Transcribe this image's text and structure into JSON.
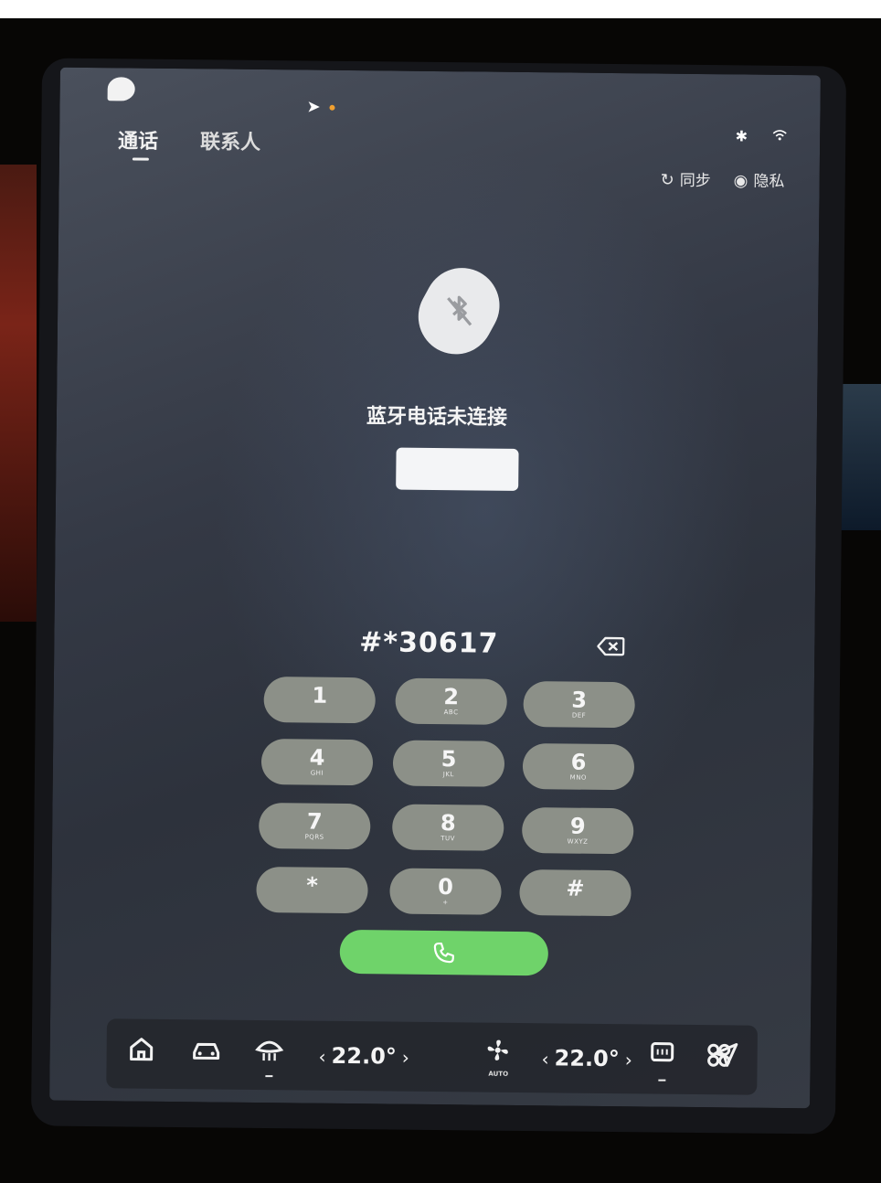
{
  "tabs": {
    "call": "通话",
    "contacts": "联系人"
  },
  "actions": {
    "sync": "同步",
    "privacy": "隐私"
  },
  "bluetooth": {
    "status": "蓝牙电话未连接",
    "connect_button": ""
  },
  "dialer": {
    "input": "#*30617",
    "keys": [
      {
        "num": "1",
        "sub": ""
      },
      {
        "num": "2",
        "sub": "ABC"
      },
      {
        "num": "3",
        "sub": "DEF"
      },
      {
        "num": "4",
        "sub": "GHI"
      },
      {
        "num": "5",
        "sub": "JKL"
      },
      {
        "num": "6",
        "sub": "MNO"
      },
      {
        "num": "7",
        "sub": "PQRS"
      },
      {
        "num": "8",
        "sub": "TUV"
      },
      {
        "num": "9",
        "sub": "WXYZ"
      },
      {
        "num": "*",
        "sub": ""
      },
      {
        "num": "0",
        "sub": "+"
      },
      {
        "num": "#",
        "sub": ""
      }
    ]
  },
  "dock": {
    "left_temp": "22.0°",
    "right_temp": "22.0°",
    "fan_mode": "AUTO",
    "temp_decrease": "‹",
    "temp_increase": "›"
  },
  "colors": {
    "call_button": "#6fd36a",
    "key_background": "#8c9088"
  }
}
